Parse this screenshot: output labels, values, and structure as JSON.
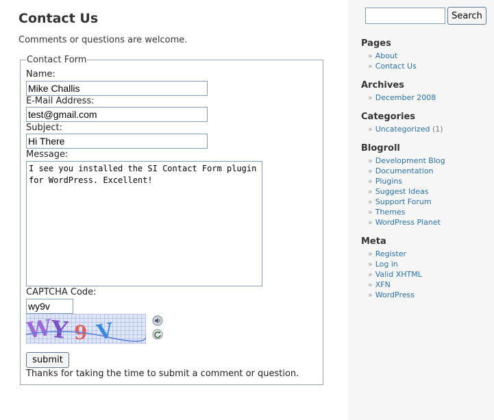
{
  "page": {
    "title": "Contact Us",
    "intro": "Comments or questions are welcome."
  },
  "form": {
    "legend": "Contact Form",
    "name_label": "Name:",
    "name_value": "Mike Challis",
    "email_label": "E-Mail Address:",
    "email_value": "test@gmail.com",
    "subject_label": "Subject:",
    "subject_value": "Hi There",
    "message_label": "Message:",
    "message_value": "I see you installed the SI Contact Form plugin for WordPress. Excellent!",
    "captcha_label": "CAPTCHA Code:",
    "captcha_value": "wy9v",
    "captcha_image_text": "WY9V",
    "submit_label": "submit",
    "thanks": "Thanks for taking the time to submit a comment or question."
  },
  "search": {
    "button_label": "Search",
    "value": ""
  },
  "sidebar": {
    "pages": {
      "heading": "Pages",
      "items": [
        "About",
        "Contact Us"
      ]
    },
    "archives": {
      "heading": "Archives",
      "items": [
        "December 2008"
      ]
    },
    "categories": {
      "heading": "Categories",
      "items": [
        {
          "label": "Uncategorized",
          "count": "(1)"
        }
      ]
    },
    "blogroll": {
      "heading": "Blogroll",
      "items": [
        "Development Blog",
        "Documentation",
        "Plugins",
        "Suggest Ideas",
        "Support Forum",
        "Themes",
        "WordPress Planet"
      ]
    },
    "meta": {
      "heading": "Meta",
      "items": [
        "Register",
        "Log in",
        "Valid XHTML",
        "XFN",
        "WordPress"
      ]
    }
  },
  "icons": {
    "audio": "speaker-icon",
    "refresh": "refresh-icon"
  },
  "colors": {
    "link": "#2a6fa8",
    "sidebar_bg": "#f6f6f6",
    "input_border": "#7f9db9"
  }
}
